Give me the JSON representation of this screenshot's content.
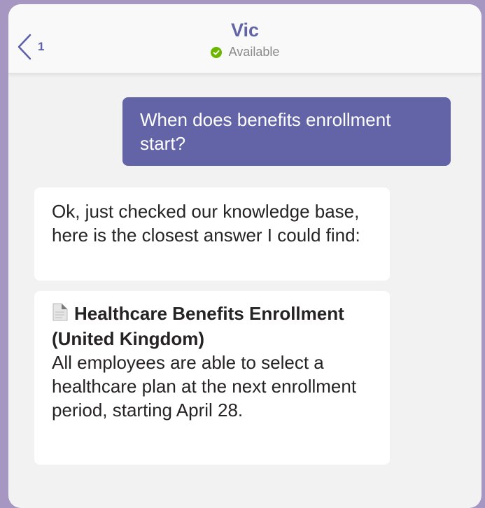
{
  "header": {
    "back_count": "1",
    "contact_name": "Vic",
    "status": "Available",
    "status_color": "#6bb700",
    "accent": "#6264a7"
  },
  "messages": {
    "user_question": "When does benefits enrollment start?",
    "bot_intro": "Ok, just checked our knowledge base, here is the closest answer I could find:",
    "card": {
      "icon": "document-icon",
      "title": "Healthcare Benefits Enrollment (United Kingdom)",
      "body": "All employees are able to select a healthcare plan at the next enrollment period, starting April 28."
    }
  }
}
